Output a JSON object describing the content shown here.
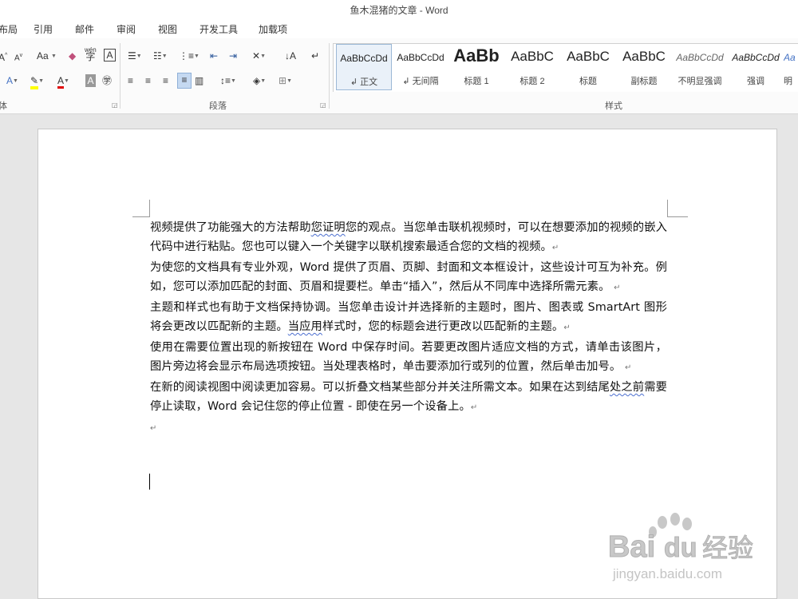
{
  "window": {
    "title": "鱼木混猪的文章 - Word"
  },
  "tabs": [
    "布局",
    "引用",
    "邮件",
    "审阅",
    "视图",
    "开发工具",
    "加载项"
  ],
  "groups": {
    "font_label": "体",
    "paragraph_label": "段落",
    "styles_label": "样式"
  },
  "styles": [
    {
      "sample": "AaBbCcDd",
      "name": "正文",
      "selected": true
    },
    {
      "sample": "AaBbCcDd",
      "name": "无间隔"
    },
    {
      "sample": "AaBb",
      "name": "标题 1"
    },
    {
      "sample": "AaBbC",
      "name": "标题 2"
    },
    {
      "sample": "AaBbC",
      "name": "标题"
    },
    {
      "sample": "AaBbC",
      "name": "副标题"
    },
    {
      "sample": "AaBbCcDd",
      "name": "不明显强调"
    },
    {
      "sample": "AaBbCcDd",
      "name": "强调"
    },
    {
      "sample": "Aa",
      "name": "明"
    }
  ],
  "font_controls": {
    "font_size_grow": "A",
    "font_size_shrink": "A",
    "change_case": "Aa",
    "phonetic": "wén",
    "border_char": "A",
    "enclose_char": "字",
    "clear_format": "A"
  },
  "colors": {
    "highlight": "#ffff00",
    "font_color": "#e00000",
    "accent": "#2b579a"
  },
  "document": {
    "p1_a": "视频提供了功能强大的方法帮助",
    "p1_sq": "您证明",
    "p1_b": "您的观点。当您单击联机视频时，可以在想要添加的视频的嵌入代码中进行粘贴。您也可以键入一个关键字以联机搜索最适合您的文档的视频。",
    "p2": "为使您的文档具有专业外观，Word 提供了页眉、页脚、封面和文本框设计，这些设计可互为补充。例如，您可以添加匹配的封面、页眉和提要栏。单击“插入”，然后从不同库中选择所需元素。",
    "p3_a": "主题和样式也有助于文档保持协调。当您单击设计并选择新的主题时，图片、图表或 SmartArt 图形将会更改以匹配新的主题。",
    "p3_sq": "当应用",
    "p3_b": "样式时，您的标题会进行更改以匹配新的主题。",
    "p4": "使用在需要位置出现的新按钮在 Word 中保存时间。若要更改图片适应文档的方式，请单击该图片，图片旁边将会显示布局选项按钮。当处理表格时，单击要添加行或列的位置，然后单击加号。",
    "p5_a": "在新的阅读视图中阅读更加容易。可以折叠文档某些部分并关注所需文本。如果在达到结尾",
    "p5_sq": "处之前",
    "p5_b": "需要停止读取，Word 会记住您的停止位置 - 即使在另一个设备上。",
    "para_mark": "↵"
  },
  "watermark": {
    "brand": "Bai",
    "brand2": "du",
    "brand_cn": "经验",
    "url": "jingyan.baidu.com"
  }
}
